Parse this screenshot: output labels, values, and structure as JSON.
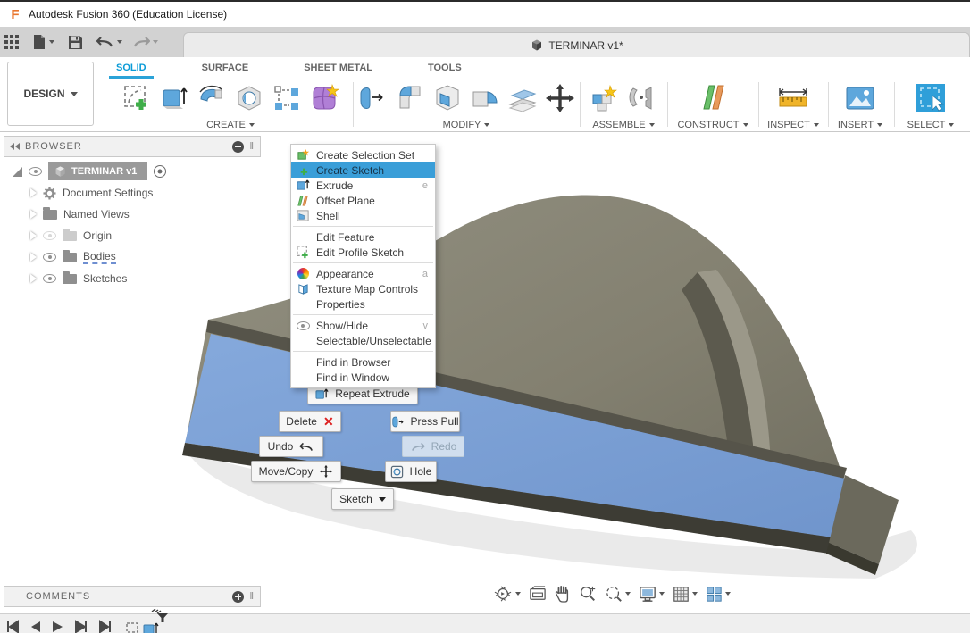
{
  "title_bar": {
    "app_title": "Autodesk Fusion 360 (Education License)"
  },
  "quick_access": {
    "document_tab": "TERMINAR v1*"
  },
  "ribbon": {
    "workspace": "DESIGN",
    "tabs": [
      {
        "label": "SOLID",
        "active": true
      },
      {
        "label": "SURFACE",
        "active": false
      },
      {
        "label": "SHEET METAL",
        "active": false
      },
      {
        "label": "TOOLS",
        "active": false
      }
    ],
    "groups": [
      {
        "label": "CREATE"
      },
      {
        "label": "MODIFY"
      },
      {
        "label": "ASSEMBLE"
      },
      {
        "label": "CONSTRUCT"
      },
      {
        "label": "INSPECT"
      },
      {
        "label": "INSERT"
      },
      {
        "label": "SELECT"
      }
    ]
  },
  "browser": {
    "header": "BROWSER",
    "root_label": "TERMINAR v1",
    "items": [
      {
        "label": "Document Settings",
        "icon": "gear-icon",
        "eye": "none"
      },
      {
        "label": "Named Views",
        "icon": "folder-icon",
        "eye": "none"
      },
      {
        "label": "Origin",
        "icon": "folder-icon",
        "eye": "hidden"
      },
      {
        "label": "Bodies",
        "icon": "folder-icon",
        "eye": "visible"
      },
      {
        "label": "Sketches",
        "icon": "folder-icon",
        "eye": "visible"
      }
    ]
  },
  "context_menu": {
    "sections": [
      {
        "items": [
          {
            "label": "Create Selection Set",
            "icon": "selection-set-icon"
          },
          {
            "label": "Create Sketch",
            "icon": "create-sketch-icon",
            "highlighted": true
          },
          {
            "label": "Extrude",
            "icon": "extrude-icon",
            "shortcut": "e"
          },
          {
            "label": "Offset Plane",
            "icon": "offset-plane-icon"
          },
          {
            "label": "Shell",
            "icon": "shell-icon"
          }
        ]
      },
      {
        "items": [
          {
            "label": "Edit Feature"
          },
          {
            "label": "Edit Profile Sketch",
            "icon": "edit-profile-sketch-icon"
          }
        ]
      },
      {
        "items": [
          {
            "label": "Appearance",
            "icon": "appearance-icon",
            "shortcut": "a"
          },
          {
            "label": "Texture Map Controls",
            "icon": "texture-map-icon"
          },
          {
            "label": "Properties"
          }
        ]
      },
      {
        "items": [
          {
            "label": "Show/Hide",
            "icon": "eye-icon",
            "shortcut": "v"
          },
          {
            "label": "Selectable/Unselectable"
          }
        ]
      },
      {
        "items": [
          {
            "label": "Find in Browser"
          },
          {
            "label": "Find in Window"
          }
        ]
      }
    ]
  },
  "marking_menu": {
    "repeat_extrude": "Repeat Extrude",
    "delete": "Delete",
    "press_pull": "Press Pull",
    "undo": "Undo",
    "redo": "Redo",
    "move_copy": "Move/Copy",
    "hole": "Hole",
    "sketch": "Sketch"
  },
  "comments_panel": {
    "header": "COMMENTS"
  },
  "icons": {
    "fusion-logo": "F",
    "app-grid-icon": "3x3 dot grid",
    "file-icon": "page with folded corner",
    "save-icon": "floppy disk",
    "undo-icon": "curved left arrow",
    "redo-icon": "curved right arrow",
    "document-cube-icon": "shaded cube",
    "eye-icon": "eye ellipse with pupil",
    "gear-icon": "cog wheel",
    "folder-icon": "folder",
    "appearance-icon": "color wheel",
    "move-icon": "four-way arrow",
    "delete-x-icon": "red X"
  },
  "colors": {
    "accent_blue": "#0a9bd7",
    "menu_highlight": "#3a9ed8",
    "model_body": "#837f70",
    "model_face_blue": "#7ba2d8",
    "qat_gray": "#d2d2d2"
  }
}
